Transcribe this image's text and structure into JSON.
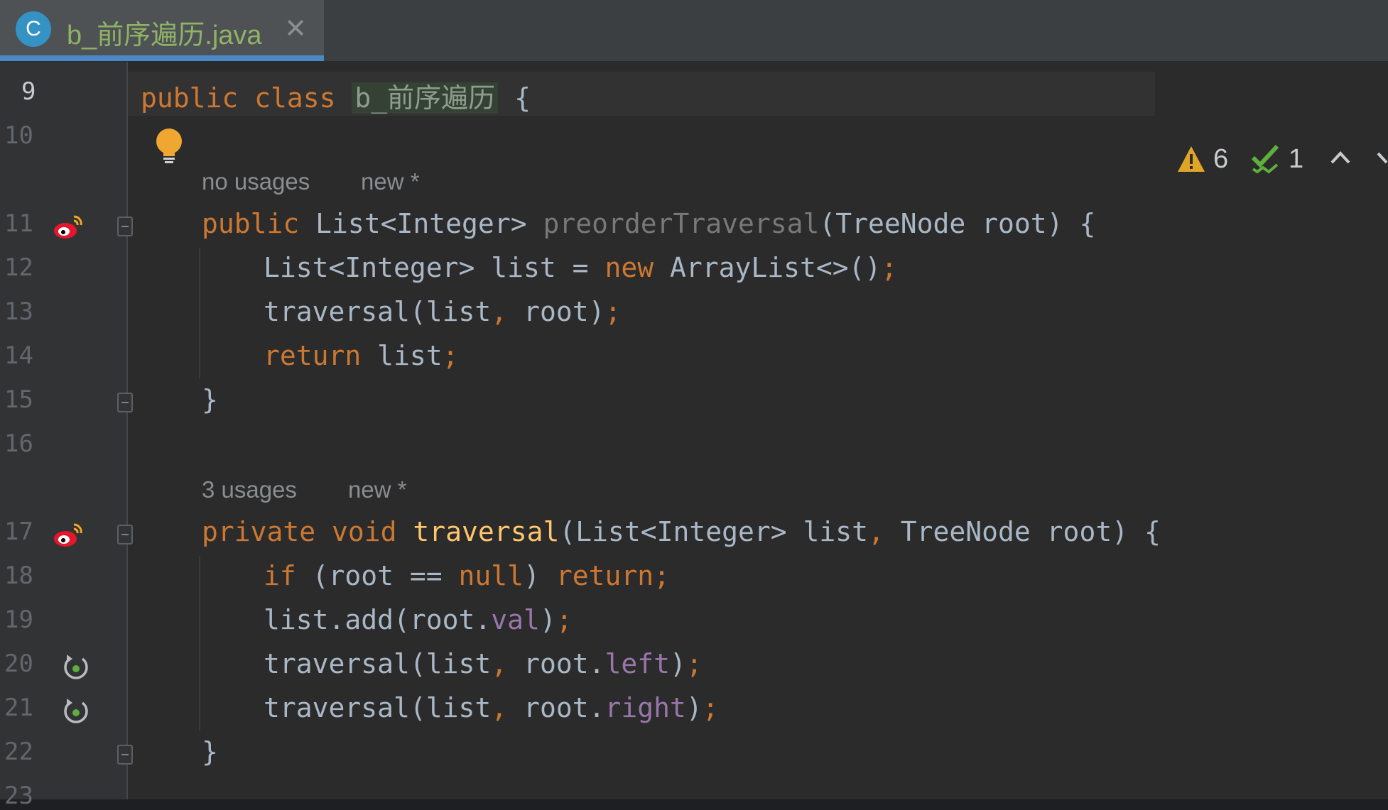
{
  "tab": {
    "icon_letter": "C",
    "filename": "b_前序遍历.java",
    "close_glyph": "✕"
  },
  "inspections": {
    "warnings": "6",
    "checks": "1"
  },
  "lines": [
    {
      "no": "9"
    },
    {
      "no": "10"
    },
    {
      "no": "11"
    },
    {
      "no": "12"
    },
    {
      "no": "13"
    },
    {
      "no": "14"
    },
    {
      "no": "15"
    },
    {
      "no": "16"
    },
    {
      "no": "17"
    },
    {
      "no": "18"
    },
    {
      "no": "19"
    },
    {
      "no": "20"
    },
    {
      "no": "21"
    },
    {
      "no": "22"
    },
    {
      "no": "23"
    }
  ],
  "hints": {
    "method1_usages": "no usages",
    "method1_new": "new *",
    "method2_usages": "3 usages",
    "method2_new": "new *"
  },
  "code": {
    "l9_kw": "public class ",
    "l9_class": "b_前序遍历",
    "l9_rest": " {",
    "l11_kw": "public ",
    "l11_type": "List<Integer> ",
    "l11_name": "preorderTraversal",
    "l11_rest": "(TreeNode root) {",
    "l12_a": "List<Integer> list = ",
    "l12_kw": "new ",
    "l12_b": "ArrayList<>()",
    "l12_semi": ";",
    "l13_a": "traversal(list",
    "l13_comma": ", ",
    "l13_b": "root)",
    "l13_semi": ";",
    "l14_kw": "return ",
    "l14_a": "list",
    "l14_semi": ";",
    "l15": "}",
    "l17_kw": "private void ",
    "l17_name": "traversal",
    "l17_a": "(List<Integer> list",
    "l17_comma": ", ",
    "l17_b": "TreeNode root) {",
    "l18_kw1": "if ",
    "l18_a": "(root == ",
    "l18_kw2": "null",
    "l18_b": ") ",
    "l18_kw3": "return",
    "l18_semi": ";",
    "l19_a": "list.add(root.",
    "l19_field": "val",
    "l19_b": ")",
    "l19_semi": ";",
    "l20_a": "traversal(list",
    "l20_comma": ", ",
    "l20_b": "root.",
    "l20_field": "left",
    "l20_c": ")",
    "l20_semi": ";",
    "l21_a": "traversal(list",
    "l21_comma": ", ",
    "l21_b": "root.",
    "l21_field": "right",
    "l21_c": ")",
    "l21_semi": ";",
    "l22": "}"
  },
  "colors": {
    "keyword": "#cc7832",
    "function": "#ffc66d",
    "field": "#9876aa",
    "text": "#a9b7c6",
    "tab_label": "#8fb267",
    "warning": "#e0a526",
    "check": "#5faf3d"
  }
}
